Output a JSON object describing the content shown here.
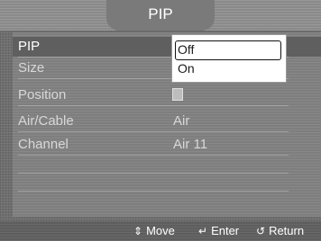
{
  "title": "PIP",
  "menu": [
    {
      "label": "PIP",
      "value": "",
      "active": true
    },
    {
      "label": "Size",
      "value": ""
    },
    {
      "label": "Position",
      "value": ""
    },
    {
      "label": "Air/Cable",
      "value": "Air"
    },
    {
      "label": "Channel",
      "value": "Air 11"
    }
  ],
  "dropdown": {
    "options": [
      "Off",
      "On"
    ],
    "selected": "Off"
  },
  "footer": {
    "move": "Move",
    "enter": "Enter",
    "return": "Return"
  },
  "icons": {
    "move": "up-down-arrows-icon",
    "enter": "enter-icon",
    "return": "return-icon"
  }
}
